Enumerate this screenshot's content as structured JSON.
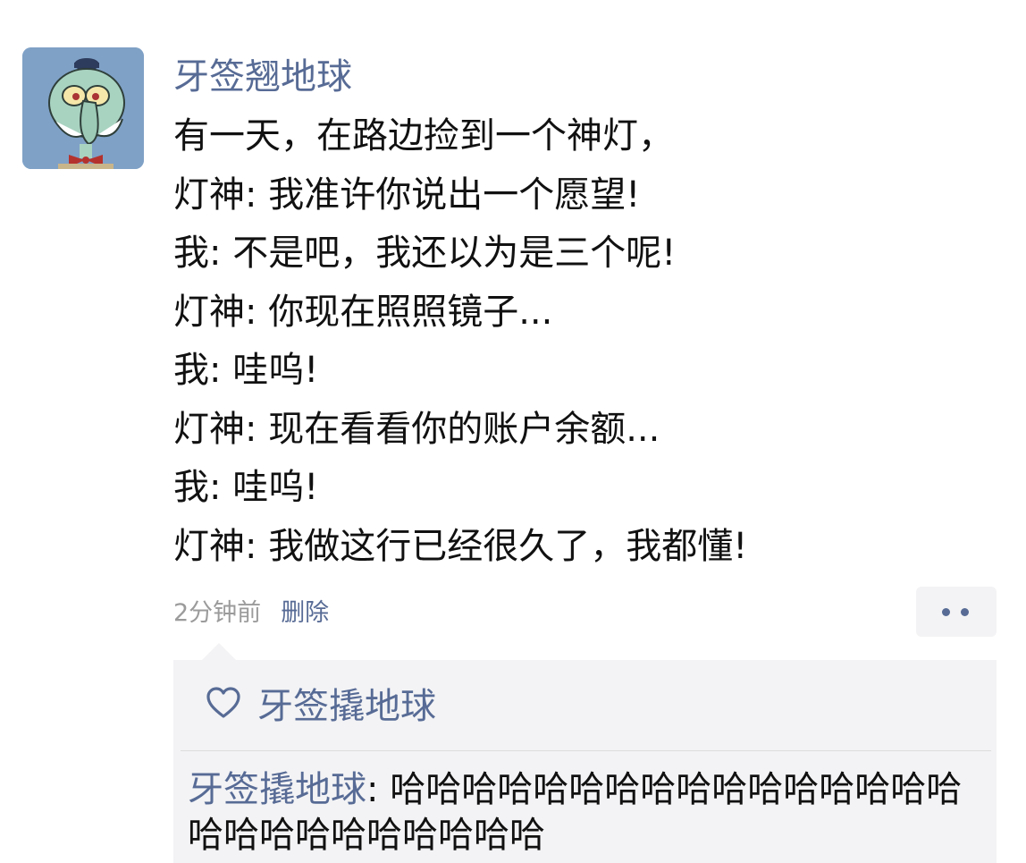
{
  "post": {
    "author": "牙签翘地球",
    "lines": [
      "有一天，在路边捡到一个神灯，",
      "灯神: 我准许你说出一个愿望!",
      "我: 不是吧，我还以为是三个呢!",
      "灯神: 你现在照照镜子...",
      "我: 哇呜!",
      "灯神: 现在看看你的账户余额...",
      "我: 哇呜!",
      "灯神: 我做这行已经很久了，我都懂!"
    ],
    "time": "2分钟前",
    "delete_label": "删除"
  },
  "interactions": {
    "likes": [
      "牙签撬地球"
    ],
    "comments": [
      {
        "author": "牙签撬地球",
        "separator": ": ",
        "text": "哈哈哈哈哈哈哈哈哈哈哈哈哈哈哈哈哈哈哈哈哈哈哈哈哈哈"
      }
    ]
  },
  "icons": {
    "like": "heart-outline-icon",
    "more": "more-dots-icon"
  },
  "colors": {
    "link": "#576b95",
    "text": "#111111",
    "meta": "#9b9b9b",
    "panel": "#f3f3f5"
  }
}
